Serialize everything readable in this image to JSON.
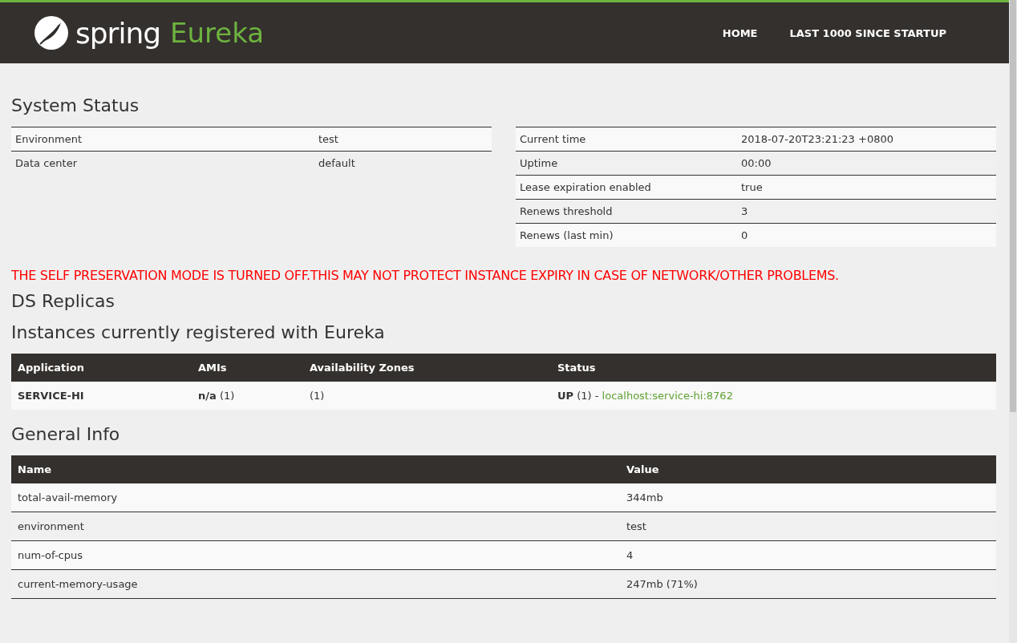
{
  "header": {
    "logo_word": "spring",
    "logo_product": "Eureka",
    "nav": [
      {
        "label": "HOME"
      },
      {
        "label": "LAST 1000 SINCE STARTUP"
      }
    ]
  },
  "system_status": {
    "title": "System Status",
    "left_rows": [
      {
        "name": "Environment",
        "value": "test"
      },
      {
        "name": "Data center",
        "value": "default"
      }
    ],
    "right_rows": [
      {
        "name": "Current time",
        "value": "2018-07-20T23:21:23 +0800"
      },
      {
        "name": "Uptime",
        "value": "00:00"
      },
      {
        "name": "Lease expiration enabled",
        "value": "true"
      },
      {
        "name": "Renews threshold",
        "value": "3"
      },
      {
        "name": "Renews (last min)",
        "value": "0"
      }
    ]
  },
  "warning": "THE SELF PRESERVATION MODE IS TURNED OFF.THIS MAY NOT PROTECT INSTANCE EXPIRY IN CASE OF NETWORK/OTHER PROBLEMS.",
  "ds_replicas": {
    "title": "DS Replicas"
  },
  "instances": {
    "title": "Instances currently registered with Eureka",
    "columns": [
      "Application",
      "AMIs",
      "Availability Zones",
      "Status"
    ],
    "rows": [
      {
        "application": "SERVICE-HI",
        "amis": "**n/a** (1)",
        "zones": "(1)",
        "status": "**UP** (1) -",
        "link": "localhost:service-hi:8762"
      }
    ]
  },
  "general_info": {
    "title": "General Info",
    "columns": [
      "Name",
      "Value"
    ],
    "rows": [
      {
        "name": "total-avail-memory",
        "value": "344mb"
      },
      {
        "name": "environment",
        "value": "test"
      },
      {
        "name": "num-of-cpus",
        "value": "4"
      },
      {
        "name": "current-memory-usage",
        "value": "247mb (71%)"
      }
    ]
  }
}
